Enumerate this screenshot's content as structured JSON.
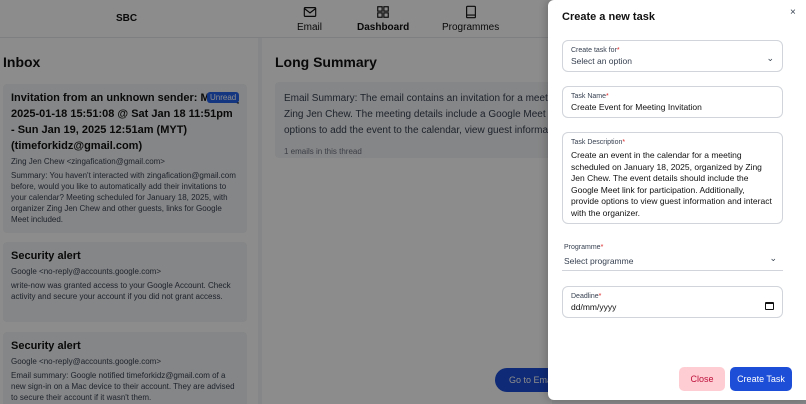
{
  "nav": {
    "brand": "SBC",
    "items": [
      {
        "label": "Email",
        "icon": "mail-icon"
      },
      {
        "label": "Dashboard",
        "icon": "grid-icon"
      },
      {
        "label": "Programmes",
        "icon": "book-icon"
      }
    ]
  },
  "inbox": {
    "title": "Inbox",
    "emails": [
      {
        "subject": "Invitation from an unknown sender: Meeting Invitation",
        "badge": "Unread",
        "details": "2025-01-18 15:51:08 @ Sat Jan 18 11:51pm - Sun Jan 19, 2025 12:51am (MYT) (timeforkidz@gmail.com)",
        "from": "Zing Jen Chew <zingafication@gmail.com>",
        "summary": "Summary: You haven't interacted with zingafication@gmail.com before, would you like to automatically add their invitations to your calendar? Meeting scheduled for January 18, 2025, with organizer Zing Jen Chew and other guests, links for Google Meet included."
      },
      {
        "subject": "Security alert",
        "from": "Google <no-reply@accounts.google.com>",
        "summary": "write-now was granted access to your Google Account. Check activity and secure your account if you did not grant access."
      },
      {
        "subject": "Security alert",
        "from": "Google <no-reply@accounts.google.com>",
        "summary": "Email summary: Google notified timeforkidz@gmail.com of a new sign-in on a Mac device to their account. They are advised to secure their account if it wasn't them."
      }
    ]
  },
  "summary": {
    "title": "Long Summary",
    "line1": "Email Summary: The email contains an invitation for a meeting",
    "line2": "Zing Jen Chew. The meeting details include a Google Meet link",
    "line3": "options to add the event to the calendar, view guest information",
    "count": "1 emails in this thread",
    "goto_label": "Go to Email"
  },
  "modal": {
    "title": "Create a new task",
    "close_icon": "×",
    "task_for": {
      "label": "Create task for",
      "placeholder": "Select an option"
    },
    "task_name": {
      "label": "Task Name",
      "value": "Create Event for Meeting Invitation"
    },
    "task_description": {
      "label": "Task Description",
      "value": "Create an event in the calendar for a meeting scheduled on January 18, 2025, organized by Zing Jen Chew. The event details should include the Google Meet link for participation. Additionally, provide options to view guest information and interact with the organizer."
    },
    "programme": {
      "label": "Programme",
      "placeholder": "Select programme"
    },
    "deadline": {
      "label": "Deadline",
      "placeholder": "dd/mm/yyyy"
    },
    "close_button": "Close",
    "create_button": "Create Task"
  },
  "colors": {
    "primary": "#1d4ed8",
    "danger_bg": "#fecdd3",
    "danger_text": "#be123c",
    "required": "#dc2626"
  }
}
